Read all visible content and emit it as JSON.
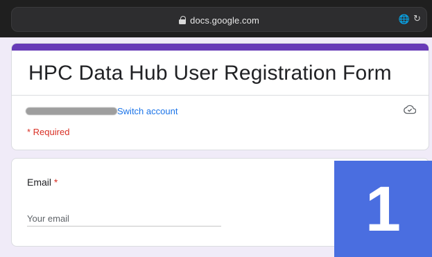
{
  "browser": {
    "url": "docs.google.com",
    "lock_icon": "lock-icon",
    "translate_icon_glyph": "🌐",
    "reload_icon_glyph": "↻"
  },
  "header": {
    "title": "HPC Data Hub User Registration Form",
    "switch_account_label": "Switch account",
    "required_note": "* Required",
    "cloud_icon": "cloud-saved-icon"
  },
  "question": {
    "label": "Email",
    "required_marker": "*",
    "input_placeholder": "Your email",
    "input_value": ""
  },
  "overlay": {
    "step_number": "1"
  },
  "colors": {
    "accent": "#673ab7",
    "link": "#1a73e8",
    "required": "#d93025",
    "badge": "#4a6ee0",
    "page_bg": "#f0ebf8"
  }
}
